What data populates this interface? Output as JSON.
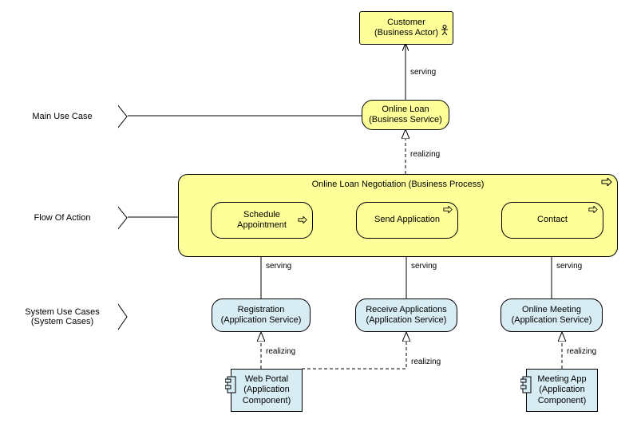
{
  "labels": {
    "mainUseCase": "Main Use Case",
    "flowOfAction": "Flow Of Action",
    "systemUseCases": "System Use Cases\n(System Cases)"
  },
  "nodes": {
    "customer": "Customer\n(Business Actor)",
    "onlineLoan": "Online Loan\n(Business Service)",
    "processTitle": "Online Loan Negotiation (Business Process)",
    "schedule": "Schedule\nAppointment",
    "sendApp": "Send Application",
    "contact": "Contact",
    "registration": "Registration\n(Application Service)",
    "receiveApp": "Receive Applications\n(Application Service)",
    "onlineMeeting": "Online Meeting\n(Application Service)",
    "webPortal": "Web Portal\n(Application\nComponent)",
    "meetingApp": "Meeting App\n(Application\nComponent)"
  },
  "edges": {
    "serving": "serving",
    "realizing": "realizing"
  }
}
